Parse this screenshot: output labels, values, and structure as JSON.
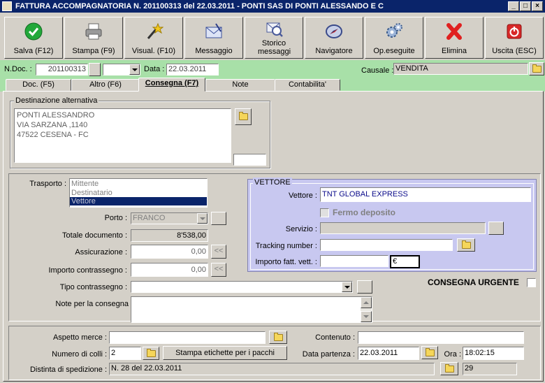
{
  "window": {
    "title": "FATTURA ACCOMPAGNATORIA N. 201100313  del 22.03.2011 - PONTI SAS DI PONTI ALESSANDO E C",
    "minimize": "_",
    "maximize": "□",
    "close": "×"
  },
  "toolbar": [
    {
      "label": "Salva (F12)",
      "icon": "checkmark-icon"
    },
    {
      "label": "Stampa (F9)",
      "icon": "printer-icon"
    },
    {
      "label": "Visual. (F10)",
      "icon": "magic-wand-icon"
    },
    {
      "label": "Messaggio",
      "icon": "envelope-icon"
    },
    {
      "label": "Storico messaggi",
      "icon": "message-history-icon"
    },
    {
      "label": "Navigatore",
      "icon": "compass-icon"
    },
    {
      "label": "Op.eseguite",
      "icon": "gears-icon"
    },
    {
      "label": "Elimina",
      "icon": "delete-x-icon"
    },
    {
      "label": "Uscita (ESC)",
      "icon": "power-icon"
    }
  ],
  "header": {
    "ndoc_label": "N.Doc. :",
    "ndoc_value": "201100313",
    "data_label": "Data :",
    "data_value": "22.03.2011",
    "causale_label": "Causale :",
    "causale_value": "VENDITA"
  },
  "tabs": [
    "Doc. (F5)",
    "Altro (F6)",
    "Consegna (F7)",
    "Note",
    "Contabilita'"
  ],
  "destinazione": {
    "legend": "Destinazione alternativa",
    "lines": [
      "PONTI ALESSANDRO",
      "VIA SARZANA ,1140",
      "47522 CESENA  - FC"
    ]
  },
  "trasporto": {
    "label": "Trasporto :",
    "options": [
      "Mittente",
      "Destinatario",
      "Vettore"
    ],
    "selected": "Vettore"
  },
  "porto": {
    "label": "Porto :",
    "value": "FRANCO"
  },
  "totale": {
    "label": "Totale documento :",
    "value": "8'538,00"
  },
  "assicurazione": {
    "label": "Assicurazione :",
    "value": "0,00"
  },
  "contrassegno": {
    "label": "Importo contrassegno :",
    "value": "0,00"
  },
  "tipo_contrassegno": {
    "label": "Tipo contrassegno :",
    "value": ""
  },
  "note_consegna": {
    "label": "Note per la consegna",
    "value": ""
  },
  "vettore_box": {
    "legend": "VETTORE",
    "vettore_label": "Vettore :",
    "vettore_value": "TNT GLOBAL EXPRESS",
    "fermo_label": "Fermo deposito",
    "servizio_label": "Servizio :",
    "servizio_value": "",
    "tracking_label": "Tracking number :",
    "tracking_value": "",
    "importo_label": "Importo fatt. vett. :",
    "importo_value": "",
    "currency": "€"
  },
  "consegna_urgente": "CONSEGNA URGENTE",
  "bottom": {
    "aspetto_label": "Aspetto merce :",
    "aspetto_value": "",
    "contenuto_label": "Contenuto :",
    "contenuto_value": "",
    "colli_label": "Numero di colli :",
    "colli_value": "2",
    "stampa_label": "Stampa etichette per i pacchi",
    "partenza_label": "Data partenza :",
    "partenza_value": "22.03.2011",
    "ora_label": "Ora :",
    "ora_value": "18:02:15",
    "distinta_label": "Distinta di spedizione :",
    "distinta_value": "N. 28 del 22.03.2011",
    "distinta_num": "29"
  },
  "colors": {
    "titlebar": "#0a246a",
    "green": "#a8e0a8",
    "vettore_bg": "#c8c8f0",
    "selection": "#0a246a"
  }
}
